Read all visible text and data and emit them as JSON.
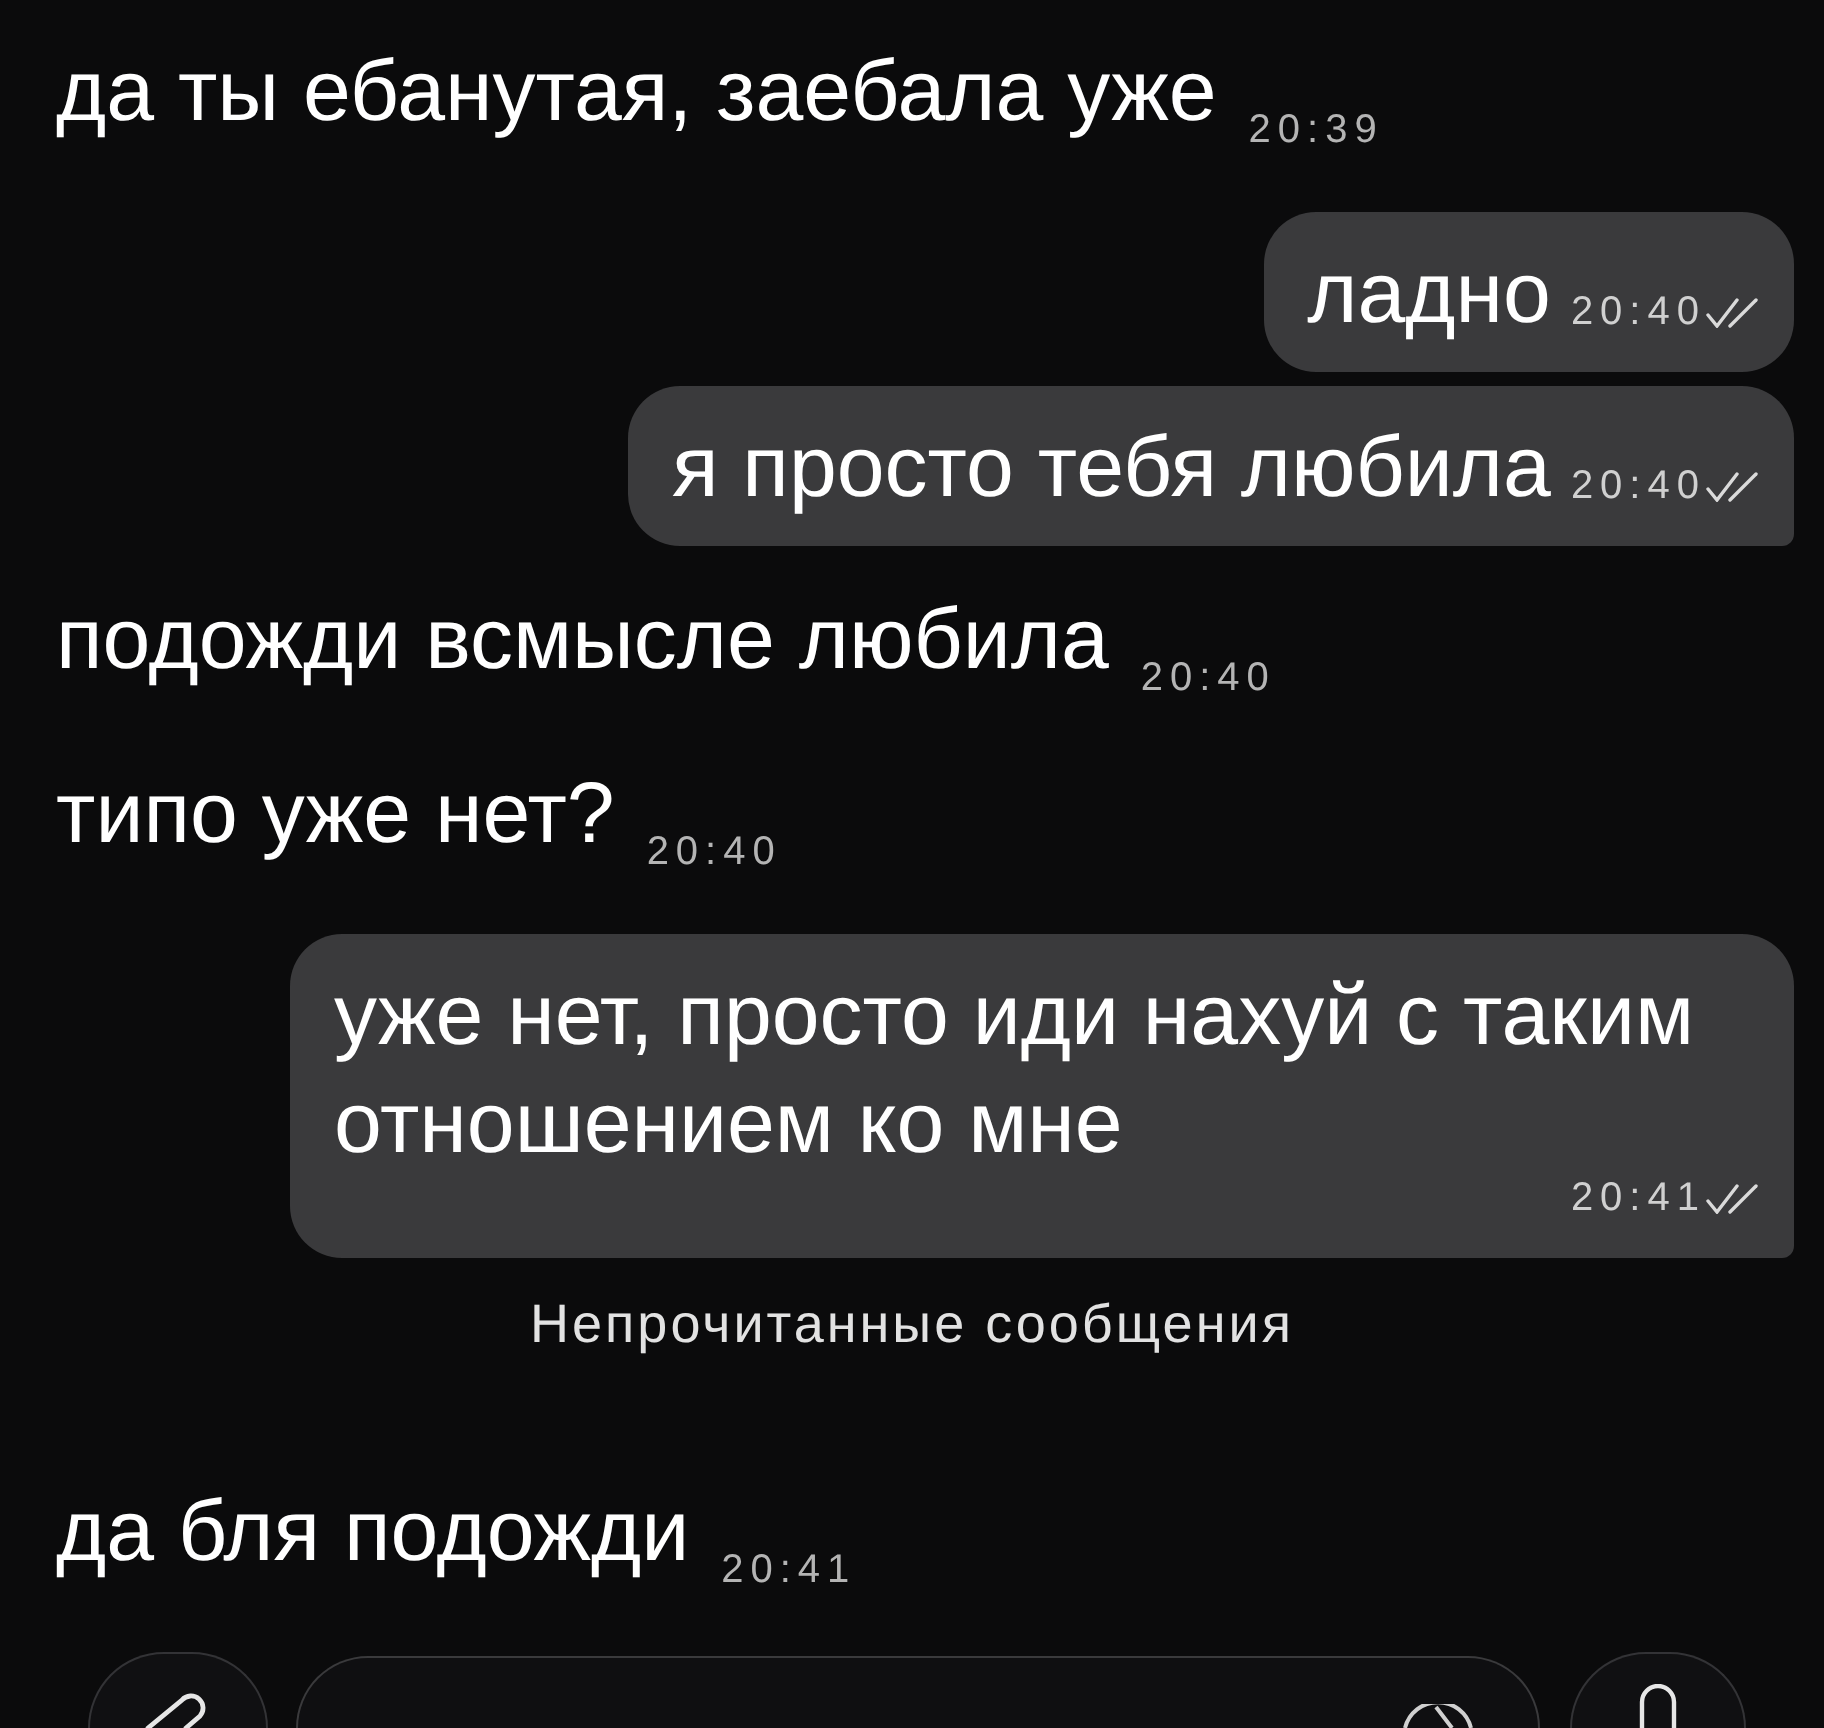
{
  "messages": [
    {
      "kind": "incoming",
      "text": "да ты ебанутая, заебала уже",
      "time": "20:39"
    },
    {
      "kind": "outgoing",
      "text": "ладно",
      "time": "20:40",
      "read": true,
      "tail": false
    },
    {
      "kind": "outgoing",
      "text": "я просто тебя любила",
      "time": "20:40",
      "read": true,
      "tail": true
    },
    {
      "kind": "incoming",
      "text": "подожди всмысле любила",
      "time": "20:40"
    },
    {
      "kind": "incoming",
      "text": "типо уже нет?",
      "time": "20:40"
    },
    {
      "kind": "outgoing",
      "text": "уже нет, просто иди нахуй с таким отношением ко мне",
      "time": "20:41",
      "read": true,
      "tail": true
    },
    {
      "kind": "divider",
      "text": "Непрочитанные сообщения"
    },
    {
      "kind": "incoming",
      "text": "да бля подожди",
      "time": "20:41"
    }
  ]
}
